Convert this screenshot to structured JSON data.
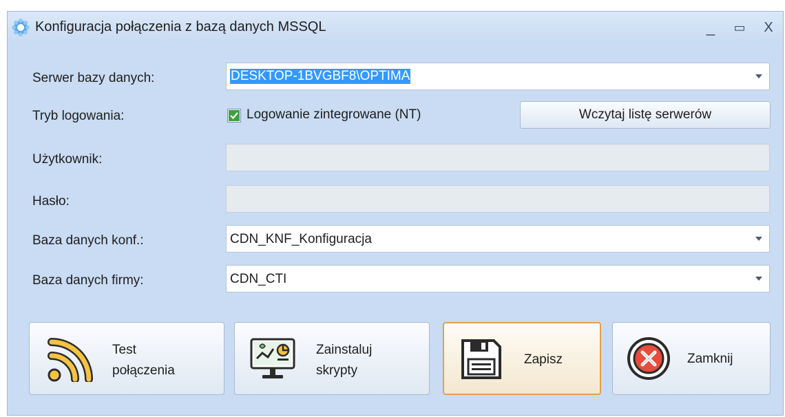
{
  "window": {
    "title": "Konfiguracja połączenia z bazą danych MSSQL",
    "minimize": "_",
    "maximize": "▭",
    "close": "X"
  },
  "form": {
    "server": {
      "label": "Serwer bazy danych:",
      "value": "DESKTOP-1BVGBF8\\OPTIMA"
    },
    "login_mode": {
      "label": "Tryb logowania:",
      "checkbox_label": "Logowanie zintegrowane (NT)",
      "checked": true
    },
    "load_servers_button": "Wczytaj listę serwerów",
    "user": {
      "label": "Użytkownik:",
      "value": ""
    },
    "password": {
      "label": "Hasło:",
      "value": ""
    },
    "config_db": {
      "label": "Baza danych konf.:",
      "value": "CDN_KNF_Konfiguracja"
    },
    "company_db": {
      "label": "Baza danych firmy:",
      "value": "CDN_CTI"
    }
  },
  "buttons": {
    "test": {
      "line1": "Test",
      "line2": "połączenia",
      "icon": "wifi-signal-icon"
    },
    "install": {
      "line1": "Zainstaluj",
      "line2": "skrypty",
      "icon": "monitor-chart-icon"
    },
    "save": {
      "label": "Zapisz",
      "icon": "floppy-disk-icon"
    },
    "close": {
      "label": "Zamknij",
      "icon": "close-circle-icon"
    }
  },
  "colors": {
    "window_bg": "#c9dcf3",
    "selection": "#3399ff",
    "active_border": "#e4a04b",
    "rss_yellow": "#f5c342",
    "close_red": "#e74c3c"
  }
}
